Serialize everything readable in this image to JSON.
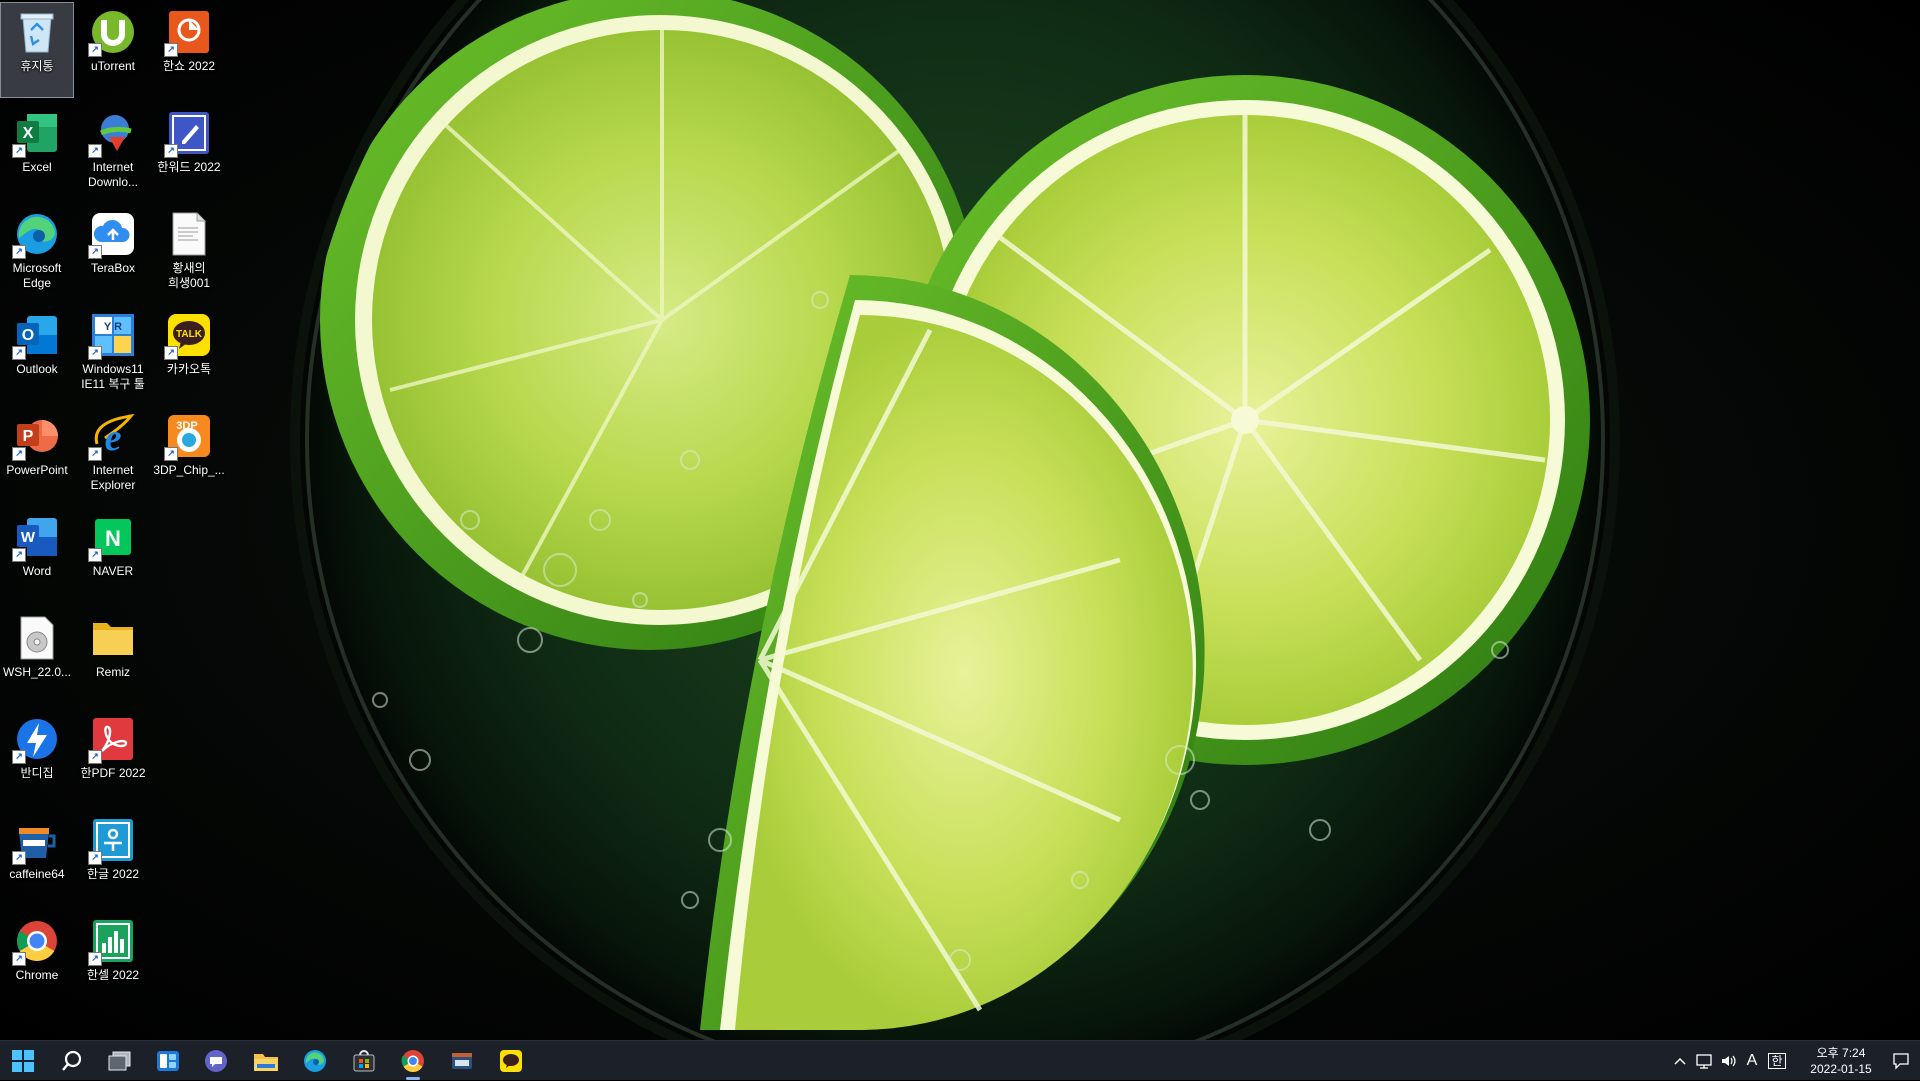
{
  "desktop": {
    "icons": [
      {
        "label": "휴지통",
        "icon": "recycle-bin-icon"
      },
      {
        "label": "uTorrent",
        "icon": "utorrent-icon"
      },
      {
        "label": "한쇼 2022",
        "icon": "hanshow-icon"
      },
      {
        "label": "Excel",
        "icon": "excel-icon"
      },
      {
        "label": "Internet\nDownlo...",
        "icon": "internet-download-manager-icon"
      },
      {
        "label": "한워드 2022",
        "icon": "hanword-icon"
      },
      {
        "label": "Microsoft\nEdge",
        "icon": "edge-icon"
      },
      {
        "label": "TeraBox",
        "icon": "terabox-icon"
      },
      {
        "label": "황새의\n희생001",
        "icon": "document-icon"
      },
      {
        "label": "Outlook",
        "icon": "outlook-icon"
      },
      {
        "label": "Windows11\nIE11 복구 툴",
        "icon": "windows-tool-icon"
      },
      {
        "label": "카카오톡",
        "icon": "kakaotalk-icon"
      },
      {
        "label": "PowerPoint",
        "icon": "powerpoint-icon"
      },
      {
        "label": "Internet\nExplorer",
        "icon": "internet-explorer-icon"
      },
      {
        "label": "3DP_Chip_...",
        "icon": "3dp-chip-icon"
      },
      {
        "label": "Word",
        "icon": "word-icon"
      },
      {
        "label": "NAVER",
        "icon": "naver-icon"
      },
      {
        "label": "WSH_22.0...",
        "icon": "disc-image-file-icon"
      },
      {
        "label": "Remiz",
        "icon": "folder-icon"
      },
      {
        "label": "반디집",
        "icon": "bandizip-icon"
      },
      {
        "label": "한PDF 2022",
        "icon": "hanpdf-icon"
      },
      {
        "label": "caffeine64",
        "icon": "caffeine-icon"
      },
      {
        "label": "한글 2022",
        "icon": "hangul-icon"
      },
      {
        "label": "Chrome",
        "icon": "chrome-icon"
      },
      {
        "label": "한셀 2022",
        "icon": "hancell-icon"
      }
    ],
    "icon_badges": {
      "excel": "X",
      "outlook": "O",
      "powerpoint": "P",
      "word": "W",
      "kakaotalk": "TALK",
      "naver": "N",
      "three_dp": "3DP",
      "windows_tool": "Y R",
      "ie": "e"
    }
  },
  "taskbar": {
    "apps": [
      {
        "name": "start-button",
        "icon": "windows-logo-icon"
      },
      {
        "name": "search-button",
        "icon": "search-icon"
      },
      {
        "name": "task-view-button",
        "icon": "task-view-icon"
      },
      {
        "name": "widgets-button",
        "icon": "widgets-icon"
      },
      {
        "name": "chat-button",
        "icon": "teams-chat-icon"
      },
      {
        "name": "file-explorer-button",
        "icon": "file-explorer-icon"
      },
      {
        "name": "edge-taskbar-button",
        "icon": "edge-icon"
      },
      {
        "name": "store-button",
        "icon": "microsoft-store-icon"
      },
      {
        "name": "chrome-taskbar-button",
        "icon": "chrome-icon",
        "active": true
      },
      {
        "name": "terminal-taskbar-button",
        "icon": "app-window-icon"
      },
      {
        "name": "kakaotalk-taskbar-button",
        "icon": "kakaotalk-icon"
      }
    ],
    "tray": {
      "ime_label": "A",
      "ime_hangul": "한"
    },
    "clock": {
      "time": "오후 7:24",
      "date": "2022-01-15"
    }
  },
  "colors": {
    "taskbar_bg": "#1c2029",
    "lime_peel": "#3fa51b",
    "lime_flesh": "#c8e35a",
    "accent": "#8ab4f8"
  }
}
